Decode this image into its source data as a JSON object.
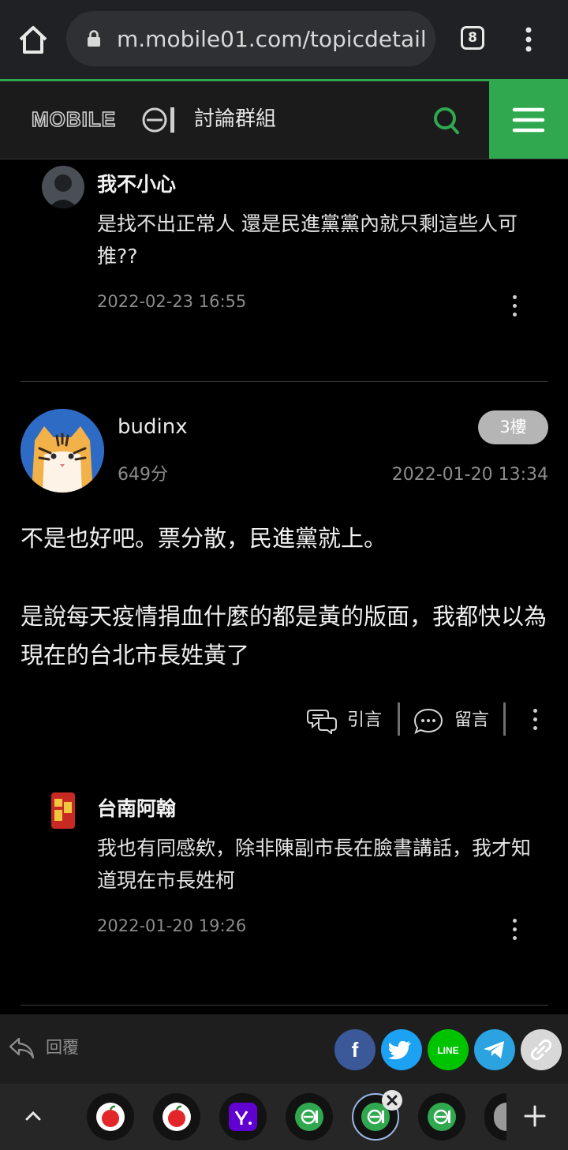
{
  "browser": {
    "url": "m.mobile01.com/topicdetail.",
    "tab_count": "8",
    "icons": [
      "home-icon",
      "lock-icon",
      "tab-switcher-icon",
      "more-vert-icon"
    ]
  },
  "site": {
    "logo_text": "MOBILE01",
    "section_title": "討論群組",
    "accent_color": "#2fa84f"
  },
  "comments_top": [
    {
      "author": "我不小心",
      "text": "是找不出正常人 還是民進黨黨內就只剩這些人可推??",
      "time": "2022-02-23 16:55"
    }
  ],
  "post": {
    "author": "budinx",
    "score": "649分",
    "floor": "3樓",
    "time": "2022-01-20 13:34",
    "paragraphs": [
      "不是也好吧。票分散，民進黨就上。",
      "是說每天疫情捐血什麼的都是黃的版面，我都快以為現在的台北市長姓黃了"
    ],
    "actions": {
      "quote": "引言",
      "comment": "留言"
    }
  },
  "comments_post": [
    {
      "author": "台南阿翰",
      "text": "我也有同感欸，除非陳副市長在臉書講話，我才知道現在市長姓柯",
      "time": "2022-01-20 19:26"
    }
  ],
  "bottom_bar": {
    "reply_label": "回覆",
    "share": [
      {
        "name": "facebook",
        "label": "f",
        "color": "#3b5998"
      },
      {
        "name": "twitter",
        "label": "",
        "color": "#1da1f2"
      },
      {
        "name": "line",
        "label": "LINE",
        "color": "#00c300"
      },
      {
        "name": "telegram",
        "label": "",
        "color": "#2aa3e0"
      },
      {
        "name": "copy-link",
        "label": "",
        "color": "#d8d8d8"
      }
    ]
  },
  "tab_strip": {
    "tabs": [
      {
        "favicon": "apple-daily-icon",
        "color": "#e3262a"
      },
      {
        "favicon": "apple-daily-icon",
        "color": "#e3262a"
      },
      {
        "favicon": "yahoo-icon",
        "color": "#6001d2"
      },
      {
        "favicon": "mobile01-icon",
        "color": "#2fa84f"
      },
      {
        "favicon": "mobile01-icon",
        "color": "#2fa84f",
        "active": true
      },
      {
        "favicon": "mobile01-icon",
        "color": "#2fa84f"
      }
    ]
  }
}
